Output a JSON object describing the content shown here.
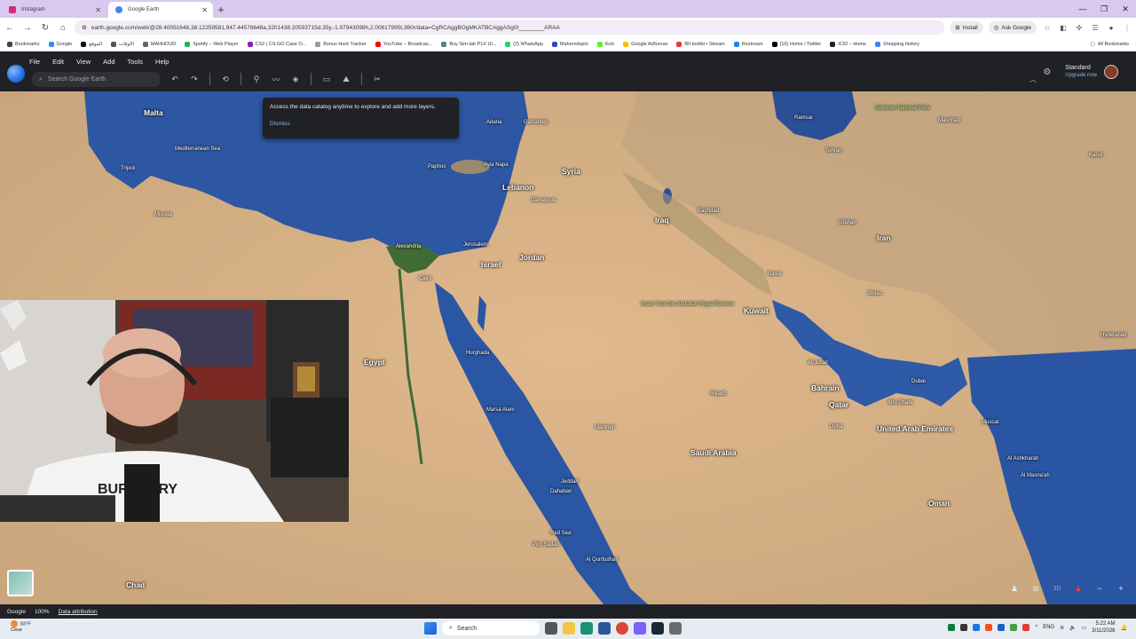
{
  "browser": {
    "tabs": [
      {
        "title": "Instagram",
        "favicon_color": "#d62976"
      },
      {
        "title": "Google Earth",
        "favicon_color": "#4285f4"
      }
    ],
    "url": "earth.google.com/web/@28.40051648,38.12259581,947.44578648a,3201438.20593715d,35y,-1.97943098h,2.00817995t,360r/data=CgRCAggBOgMKATBCAggASg0I________ARAA",
    "install_label": "Install",
    "ask_google_label": "Ask Google",
    "bookmarks": [
      {
        "label": "Bookmarks",
        "color": "#444"
      },
      {
        "label": "Google",
        "color": "#4285f4"
      },
      {
        "label": "الموقع",
        "color": "#111"
      },
      {
        "label": "الاوقات",
        "color": "#555"
      },
      {
        "label": "MAHHOUD",
        "color": "#666"
      },
      {
        "label": "Spotify – Web Player",
        "color": "#1db954"
      },
      {
        "label": "CS2 | CS:GO Case O...",
        "color": "#8e24aa"
      },
      {
        "label": "Bonus Hunt Tracker",
        "color": "#999"
      },
      {
        "label": "YouTube – Broadcas...",
        "color": "#ff0000"
      },
      {
        "label": "Buy Sim-lab P1X Ul...",
        "color": "#607d8b"
      },
      {
        "label": "(2) WhatsApp",
        "color": "#25d366"
      },
      {
        "label": "Maherndspin",
        "color": "#3949ab"
      },
      {
        "label": "Kick",
        "color": "#53fc18"
      },
      {
        "label": "Google AdSense",
        "color": "#fbbc04"
      },
      {
        "label": "BII toolkit • Stream",
        "color": "#e53935"
      },
      {
        "label": "Restream",
        "color": "#1e88e5"
      },
      {
        "label": "(16) Home / Twitter",
        "color": "#000"
      },
      {
        "label": "ICID – Home",
        "color": "#222"
      },
      {
        "label": "Shopping history",
        "color": "#4285f4"
      }
    ],
    "all_bookmarks_label": "All Bookmarks"
  },
  "earth": {
    "menu": [
      "File",
      "Edit",
      "View",
      "Add",
      "Tools",
      "Help"
    ],
    "search_placeholder": "Search Google Earth",
    "plan_name": "Standard",
    "plan_upgrade": "Upgrade now",
    "tooltip": {
      "message": "Access the data catalog anytime to explore and add more layers.",
      "dismiss": "Dismiss"
    },
    "countries": [
      {
        "id": "malta",
        "name": "Malta"
      },
      {
        "id": "syria",
        "name": "Syria"
      },
      {
        "id": "lebanon",
        "name": "Lebanon"
      },
      {
        "id": "iraq",
        "name": "Iraq"
      },
      {
        "id": "iran",
        "name": "Iran"
      },
      {
        "id": "israel",
        "name": "Israel"
      },
      {
        "id": "jordan",
        "name": "Jordan"
      },
      {
        "id": "kuwait",
        "name": "Kuwait"
      },
      {
        "id": "egypt",
        "name": "Egypt"
      },
      {
        "id": "bahrain",
        "name": "Bahrain"
      },
      {
        "id": "qatar",
        "name": "Qatar"
      },
      {
        "id": "uae",
        "name": "United Arab Emirates"
      },
      {
        "id": "saudi",
        "name": "Saudi Arabia"
      },
      {
        "id": "oman",
        "name": "Oman"
      },
      {
        "id": "chad",
        "name": "Chad"
      }
    ],
    "cities": [
      {
        "id": "tripoli",
        "name": "Tripoli"
      },
      {
        "id": "med-sea",
        "name": "Mediterranean Sea"
      },
      {
        "id": "alexandria",
        "name": "Alexandria"
      },
      {
        "id": "jerusalem",
        "name": "Jerusalem"
      },
      {
        "id": "damascus",
        "name": "Damascus"
      },
      {
        "id": "baghdad",
        "name": "Baghdad"
      },
      {
        "id": "tehran",
        "name": "Tehran"
      },
      {
        "id": "isfahan",
        "name": "Isfahan"
      },
      {
        "id": "shiraz",
        "name": "Shiraz"
      },
      {
        "id": "kabul",
        "name": "Kabul"
      },
      {
        "id": "medina",
        "name": "Madinah"
      },
      {
        "id": "jeddah",
        "name": "Jeddah"
      },
      {
        "id": "riyadh",
        "name": "Riyadh"
      },
      {
        "id": "doha",
        "name": "Doha"
      },
      {
        "id": "dubai",
        "name": "Dubai"
      },
      {
        "id": "muscat",
        "name": "Muscat"
      },
      {
        "id": "red-sea",
        "name": "Red Sea"
      },
      {
        "id": "port-sudan",
        "name": "Port Sudan"
      },
      {
        "id": "hyderabad",
        "name": "Hyderabad"
      },
      {
        "id": "abu-dhabi",
        "name": "Abu Dhabi"
      },
      {
        "id": "al-jubail",
        "name": "Al Jubail"
      },
      {
        "id": "misrata",
        "name": "Misrata"
      },
      {
        "id": "hurghada",
        "name": "Hurghada"
      },
      {
        "id": "gaziantep",
        "name": "Gaziantep"
      },
      {
        "id": "adana",
        "name": "Adana"
      },
      {
        "id": "paphos",
        "name": "Paphos"
      },
      {
        "id": "ayia-napa",
        "name": "Ayia Napa"
      },
      {
        "id": "marsa-alam",
        "name": "Marsa Alam"
      },
      {
        "id": "dahaban",
        "name": "Dahaban"
      },
      {
        "id": "al-qunfudhah",
        "name": "Al Qunfudhah"
      },
      {
        "id": "al-masnaah",
        "name": "Al Masna'ah"
      },
      {
        "id": "al-ashkharah",
        "name": "Al Ashkharah"
      },
      {
        "id": "mashhad",
        "name": "Mashhad"
      },
      {
        "id": "ramsar",
        "name": "Ramsar"
      },
      {
        "id": "basra",
        "name": "Basra"
      },
      {
        "id": "cairo",
        "name": "Cairo"
      }
    ],
    "parks": [
      {
        "id": "imam-turki",
        "name": "Imam Turki bin Abdullah Royal Reserve"
      },
      {
        "id": "golestan",
        "name": "Golestan National Park"
      }
    ],
    "status": {
      "brand": "Google",
      "zoom": "100%",
      "attribution": "Data attribution"
    },
    "controls": {
      "three_d": "3D"
    }
  },
  "taskbar": {
    "weather_temp": "83°F",
    "weather_desc": "Clear",
    "search_label": "Search",
    "lang": "ENG",
    "time": "5:22 AM",
    "date": "3/11/2026"
  },
  "colors": {
    "sea": "#2e57a3",
    "desert": "#d9b98f",
    "ui_dark": "#202124",
    "link": "#8ab4f8"
  }
}
